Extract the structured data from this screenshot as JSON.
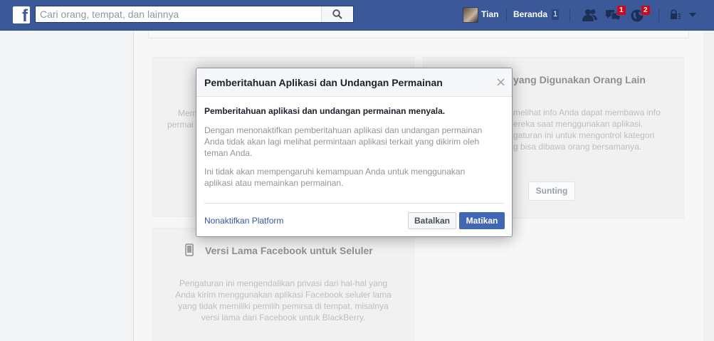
{
  "header": {
    "logo": "f",
    "search_placeholder": "Cari orang, tempat, dan lainnya",
    "user_name": "Tian",
    "home_label": "Beranda",
    "home_count": "1",
    "friend_requests_icon": "friends-icon",
    "messages_badge": "1",
    "notifications_badge": "2"
  },
  "cards": {
    "apps_others": {
      "title_visible": "yang Digunakan Orang Lain",
      "text_visible": [
        "melihat info Anda dapat membawa info",
        "ereka saat menggunakan aplikasi.",
        "gaturan ini untuk mengontrol kategori",
        "g bisa dibawa orang bersamanya."
      ],
      "edit_label": "Sunting"
    },
    "platform": {
      "text_visible": [
        "Mem",
        "permai"
      ]
    },
    "old_mobile": {
      "title": "Versi Lama Facebook untuk Seluler",
      "text": [
        "Pengaturan ini mengendalikan privasi dari hal-hal yang",
        "Anda kirim menggunakan aplikasi Facebook seluler lama",
        "yang tidak memiliki pemilih pemirsa di tempat, misalnya",
        "versi lama dari Facebook untuk BlackBerry."
      ]
    }
  },
  "dialog": {
    "title": "Pemberitahuan Aplikasi dan Undangan Permainan",
    "close": "×",
    "status": "Pemberitahuan aplikasi dan undangan permainan menyala.",
    "paragraph1": [
      "Dengan menonaktifkan pemberitahuan aplikasi dan undangan permainan",
      "Anda tidak akan lagi melihat permintaan aplikasi terkait yang dikirim oleh",
      "teman Anda."
    ],
    "paragraph2": [
      "Ini tidak akan mempengaruhi kemampuan Anda untuk menggunakan",
      "aplikasi atau memainkan permainan."
    ],
    "platform_link": "Nonaktifkan Platform",
    "cancel_label": "Batalkan",
    "confirm_label": "Matikan"
  }
}
